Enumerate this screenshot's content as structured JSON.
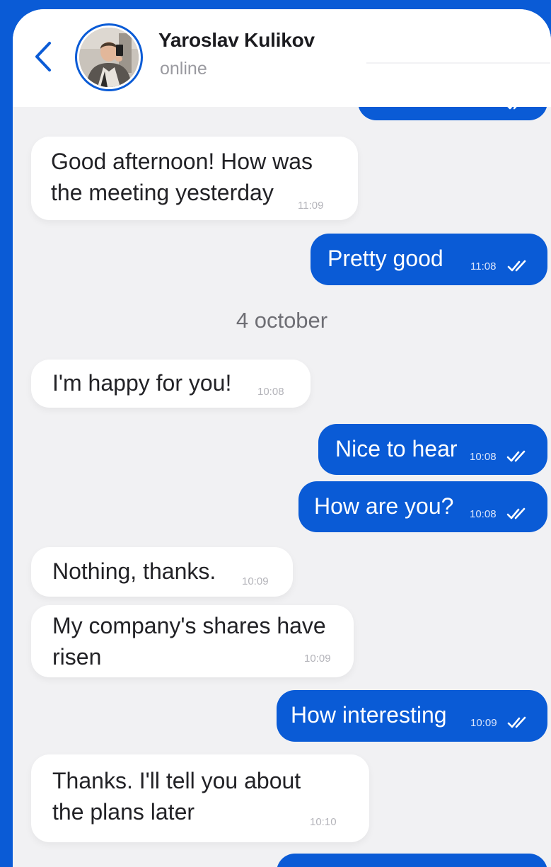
{
  "header": {
    "contact_name": "Yaroslav Kulikov",
    "status": "online"
  },
  "messages": [
    {
      "direction": "in",
      "text_lines": [
        "Good afternoon! How was",
        "the meeting yesterday"
      ],
      "time": "11:09"
    },
    {
      "direction": "out",
      "text": "Pretty good",
      "time": "11:08",
      "read": true
    },
    {
      "direction": "in",
      "text": "I'm happy for you!",
      "time": "10:08"
    },
    {
      "direction": "out",
      "text": "Nice to hear",
      "time": "10:08",
      "read": true
    },
    {
      "direction": "out",
      "text": "How are you?",
      "time": "10:08",
      "read": true
    },
    {
      "direction": "in",
      "text": "Nothing, thanks.",
      "time": "10:09"
    },
    {
      "direction": "in",
      "text_lines": [
        "My company's shares have",
        "risen"
      ],
      "time": "10:09"
    },
    {
      "direction": "out",
      "text": "How interesting",
      "time": "10:09",
      "read": true
    },
    {
      "direction": "in",
      "text_lines": [
        "Thanks. I'll tell you about",
        "the plans later"
      ],
      "time": "10:10"
    }
  ],
  "date_separator": "4 october",
  "colors": {
    "accent": "#0a5bd6",
    "background": "#f1f1f3",
    "incoming_bubble": "#ffffff"
  }
}
